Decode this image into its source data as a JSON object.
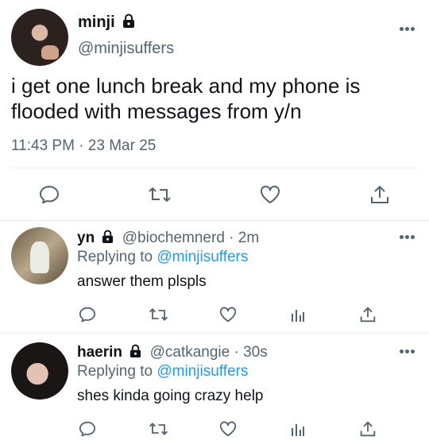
{
  "main_tweet": {
    "display_name": "minji",
    "handle": "@minjisuffers",
    "text": "i get one lunch break and my phone is flooded with messages from y/n",
    "timestamp": "11:43 PM · 23 Mar 25"
  },
  "replies": [
    {
      "display_name": "yn",
      "handle": "@biochemnerd",
      "time": "· 2m",
      "replying_prefix": "Replying to",
      "replying_to": "@minjisuffers",
      "text": "answer them plspls"
    },
    {
      "display_name": "haerin",
      "handle": "@catkangie",
      "time": "· 30s",
      "replying_prefix": "Replying to",
      "replying_to": "@minjisuffers",
      "text": "shes kinda going crazy help"
    }
  ],
  "icons": {
    "reply": "comment-icon",
    "retweet": "retweet-icon",
    "like": "heart-icon",
    "views": "analytics-icon",
    "share": "share-icon",
    "more": "more-icon",
    "lock": "lock-icon"
  },
  "colors": {
    "text": "#0f1419",
    "secondary": "#536471",
    "link": "#1d9bf0",
    "divider": "#e6ecf0"
  }
}
